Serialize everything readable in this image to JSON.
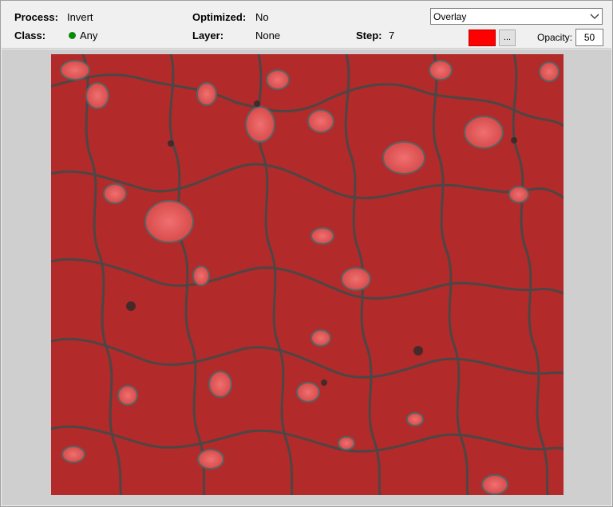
{
  "toolbar": {
    "process_label": "Process:",
    "process_value": "Invert",
    "class_label": "Class:",
    "class_value": "Any",
    "optimized_label": "Optimized:",
    "optimized_value": "No",
    "layer_label": "Layer:",
    "layer_value": "None",
    "step_label": "Step:",
    "step_value": "7",
    "mode_select": "Overlay",
    "overlay_color": "#ff0000",
    "ellipsis_label": "...",
    "opacity_label": "Opacity:",
    "opacity_value": "50"
  },
  "image": {
    "description_color": "#b52b2b"
  }
}
